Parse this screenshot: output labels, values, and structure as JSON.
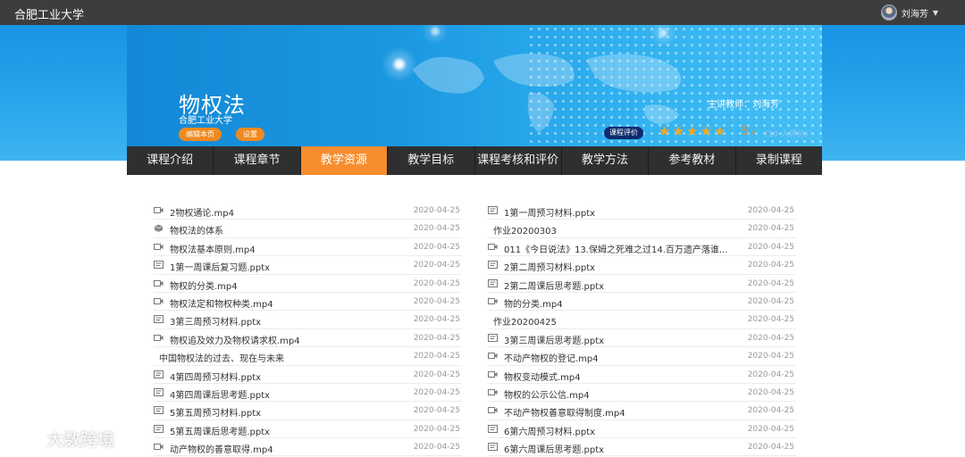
{
  "header": {
    "school": "合肥工业大学",
    "user_name": "刘海芳"
  },
  "banner": {
    "course_title": "物权法",
    "school": "合肥工业大学",
    "edit_label": "编辑本页",
    "settings_label": "设置",
    "teacher": "主讲教师：刘海芳",
    "rating_label": "课程评价",
    "rating_value": 5,
    "score_main": "5",
    "score_sub": ".0",
    "raters": "(10 人评价)",
    "colors": {
      "accent": "#f68d2e",
      "star": "#f5a623",
      "eval_badge": "#0d2b6e"
    }
  },
  "nav": {
    "tabs": [
      "课程介绍",
      "课程章节",
      "教学资源",
      "教学目标",
      "课程考核和评价",
      "教学方法",
      "参考教材",
      "录制课程"
    ],
    "active": "教学资源"
  },
  "resources": {
    "left": [
      {
        "icon": "video-icon",
        "name": "2物权通论.mp4",
        "date": "2020-04-25"
      },
      {
        "icon": "box-icon",
        "name": "物权法的体系",
        "date": "2020-04-25"
      },
      {
        "icon": "video-icon",
        "name": "物权法基本原则.mp4",
        "date": "2020-04-25"
      },
      {
        "icon": "slides-icon",
        "name": "1第一周课后复习题.pptx",
        "date": "2020-04-25"
      },
      {
        "icon": "video-icon",
        "name": "物权的分类.mp4",
        "date": "2020-04-25"
      },
      {
        "icon": "video-icon",
        "name": "物权法定和物权种类.mp4",
        "date": "2020-04-25"
      },
      {
        "icon": "slides-icon",
        "name": "3第三周预习材料.pptx",
        "date": "2020-04-25"
      },
      {
        "icon": "video-icon",
        "name": "物权追及效力及物权请求权.mp4",
        "date": "2020-04-25"
      },
      {
        "icon": "",
        "name": "中国物权法的过去、现在与未来",
        "date": "2020-04-25"
      },
      {
        "icon": "slides-icon",
        "name": "4第四周预习材料.pptx",
        "date": "2020-04-25"
      },
      {
        "icon": "slides-icon",
        "name": "4第四周课后思考题.pptx",
        "date": "2020-04-25"
      },
      {
        "icon": "slides-icon",
        "name": "5第五周预习材料.pptx",
        "date": "2020-04-25"
      },
      {
        "icon": "slides-icon",
        "name": "5第五周课后思考题.pptx",
        "date": "2020-04-25"
      },
      {
        "icon": "video-icon",
        "name": "动产物权的善意取得.mp4",
        "date": "2020-04-25"
      }
    ],
    "right": [
      {
        "icon": "slides-icon",
        "name": "1第一周预习材料.pptx",
        "date": "2020-04-25"
      },
      {
        "icon": "",
        "name": "作业20200303",
        "date": "2020-04-25"
      },
      {
        "icon": "video-icon",
        "name": "011《今日说法》13.保姆之死难之过14.百万遗产落谁...",
        "date": "2020-04-25"
      },
      {
        "icon": "slides-icon",
        "name": "2第二周预习材料.pptx",
        "date": "2020-04-25"
      },
      {
        "icon": "slides-icon",
        "name": "2第二周课后思考题.pptx",
        "date": "2020-04-25"
      },
      {
        "icon": "video-icon",
        "name": "物的分类.mp4",
        "date": "2020-04-25"
      },
      {
        "icon": "",
        "name": "作业20200425",
        "date": "2020-04-25"
      },
      {
        "icon": "slides-icon",
        "name": "3第三周课后思考题.pptx",
        "date": "2020-04-25"
      },
      {
        "icon": "video-icon",
        "name": "不动产物权的登记.mp4",
        "date": "2020-04-25"
      },
      {
        "icon": "video-icon",
        "name": "物权变动模式.mp4",
        "date": "2020-04-25"
      },
      {
        "icon": "video-icon",
        "name": "物权的公示公信.mp4",
        "date": "2020-04-25"
      },
      {
        "icon": "video-icon",
        "name": "不动产物权善意取得制度.mp4",
        "date": "2020-04-25"
      },
      {
        "icon": "slides-icon",
        "name": "6第六周预习材料.pptx",
        "date": "2020-04-25"
      },
      {
        "icon": "slides-icon",
        "name": "6第六周课后思考题.pptx",
        "date": "2020-04-25"
      }
    ]
  },
  "watermark": {
    "text": "大数跨境"
  }
}
